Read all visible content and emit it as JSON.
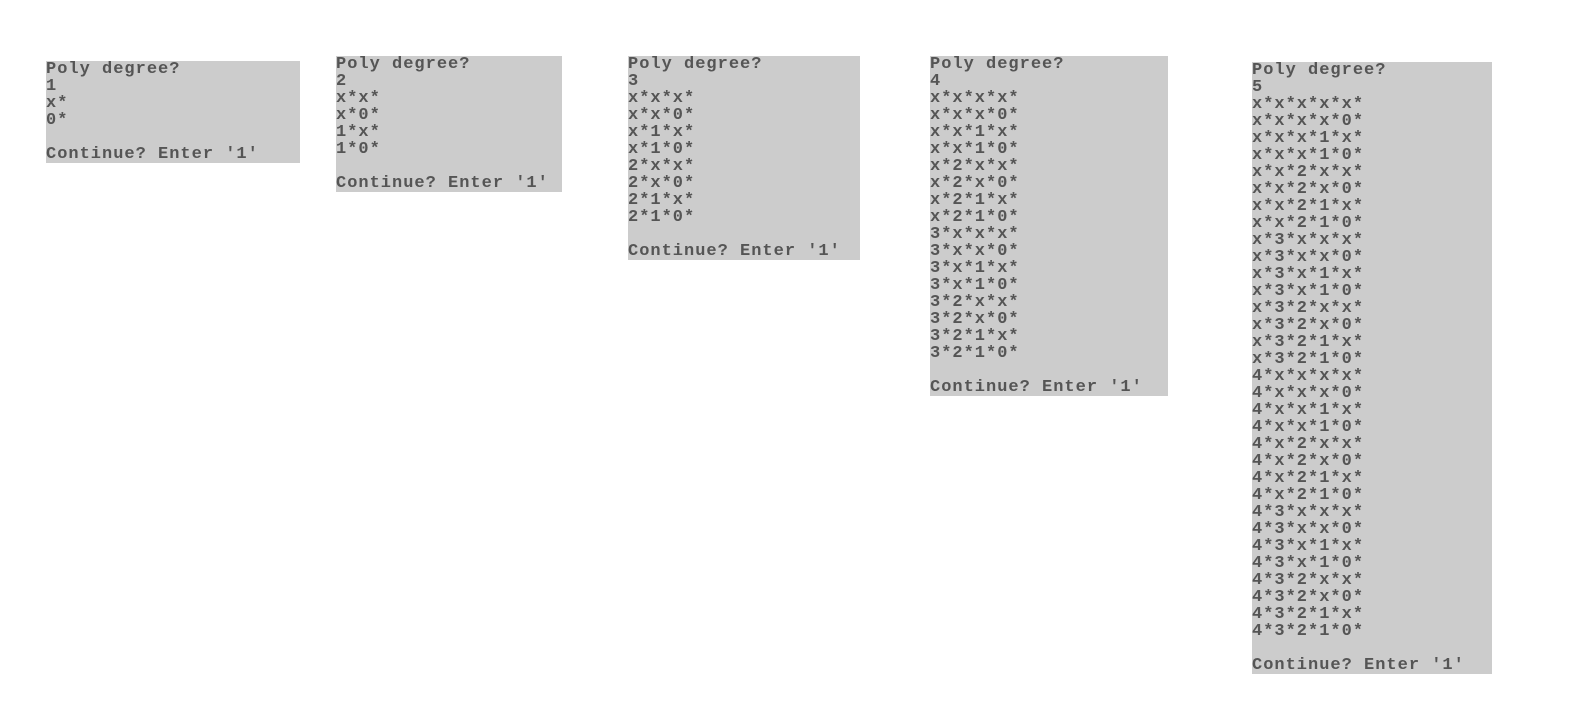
{
  "terminals": [
    {
      "prompt": "Poly degree?",
      "degree": "1",
      "lines": [
        "x*",
        "0*"
      ],
      "continue": "Continue? Enter '1'"
    },
    {
      "prompt": "Poly degree?",
      "degree": "2",
      "lines": [
        "x*x*",
        "x*0*",
        "1*x*",
        "1*0*"
      ],
      "continue": "Continue? Enter '1'"
    },
    {
      "prompt": "Poly degree?",
      "degree": "3",
      "lines": [
        "x*x*x*",
        "x*x*0*",
        "x*1*x*",
        "x*1*0*",
        "2*x*x*",
        "2*x*0*",
        "2*1*x*",
        "2*1*0*"
      ],
      "continue": "Continue? Enter '1'"
    },
    {
      "prompt": "Poly degree?",
      "degree": "4",
      "lines": [
        "x*x*x*x*",
        "x*x*x*0*",
        "x*x*1*x*",
        "x*x*1*0*",
        "x*2*x*x*",
        "x*2*x*0*",
        "x*2*1*x*",
        "x*2*1*0*",
        "3*x*x*x*",
        "3*x*x*0*",
        "3*x*1*x*",
        "3*x*1*0*",
        "3*2*x*x*",
        "3*2*x*0*",
        "3*2*1*x*",
        "3*2*1*0*"
      ],
      "continue": "Continue? Enter '1'"
    },
    {
      "prompt": "Poly degree?",
      "degree": "5",
      "lines": [
        "x*x*x*x*x*",
        "x*x*x*x*0*",
        "x*x*x*1*x*",
        "x*x*x*1*0*",
        "x*x*2*x*x*",
        "x*x*2*x*0*",
        "x*x*2*1*x*",
        "x*x*2*1*0*",
        "x*3*x*x*x*",
        "x*3*x*x*0*",
        "x*3*x*1*x*",
        "x*3*x*1*0*",
        "x*3*2*x*x*",
        "x*3*2*x*0*",
        "x*3*2*1*x*",
        "x*3*2*1*0*",
        "4*x*x*x*x*",
        "4*x*x*x*0*",
        "4*x*x*1*x*",
        "4*x*x*1*0*",
        "4*x*2*x*x*",
        "4*x*2*x*0*",
        "4*x*2*1*x*",
        "4*x*2*1*0*",
        "4*3*x*x*x*",
        "4*3*x*x*0*",
        "4*3*x*1*x*",
        "4*3*x*1*0*",
        "4*3*2*x*x*",
        "4*3*2*x*0*",
        "4*3*2*1*x*",
        "4*3*2*1*0*"
      ],
      "continue": "Continue? Enter '1'"
    }
  ]
}
